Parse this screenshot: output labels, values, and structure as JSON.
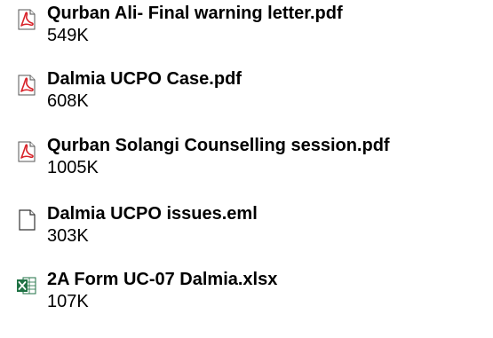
{
  "attachments": [
    {
      "name": "Qurban Ali- Final warning letter.pdf",
      "size": "549K",
      "icon": "pdf-icon"
    },
    {
      "name": "Dalmia UCPO Case.pdf",
      "size": "608K",
      "icon": "pdf-icon"
    },
    {
      "name": "Qurban Solangi Counselling session.pdf",
      "size": "1005K",
      "icon": "pdf-icon"
    },
    {
      "name": "Dalmia UCPO issues.eml",
      "size": "303K",
      "icon": "generic-file-icon"
    },
    {
      "name": "2A Form UC-07 Dalmia.xlsx",
      "size": "107K",
      "icon": "excel-icon"
    }
  ],
  "colors": {
    "pdf_red": "#d8232a",
    "excel_green": "#1f7244",
    "text": "#000000"
  }
}
